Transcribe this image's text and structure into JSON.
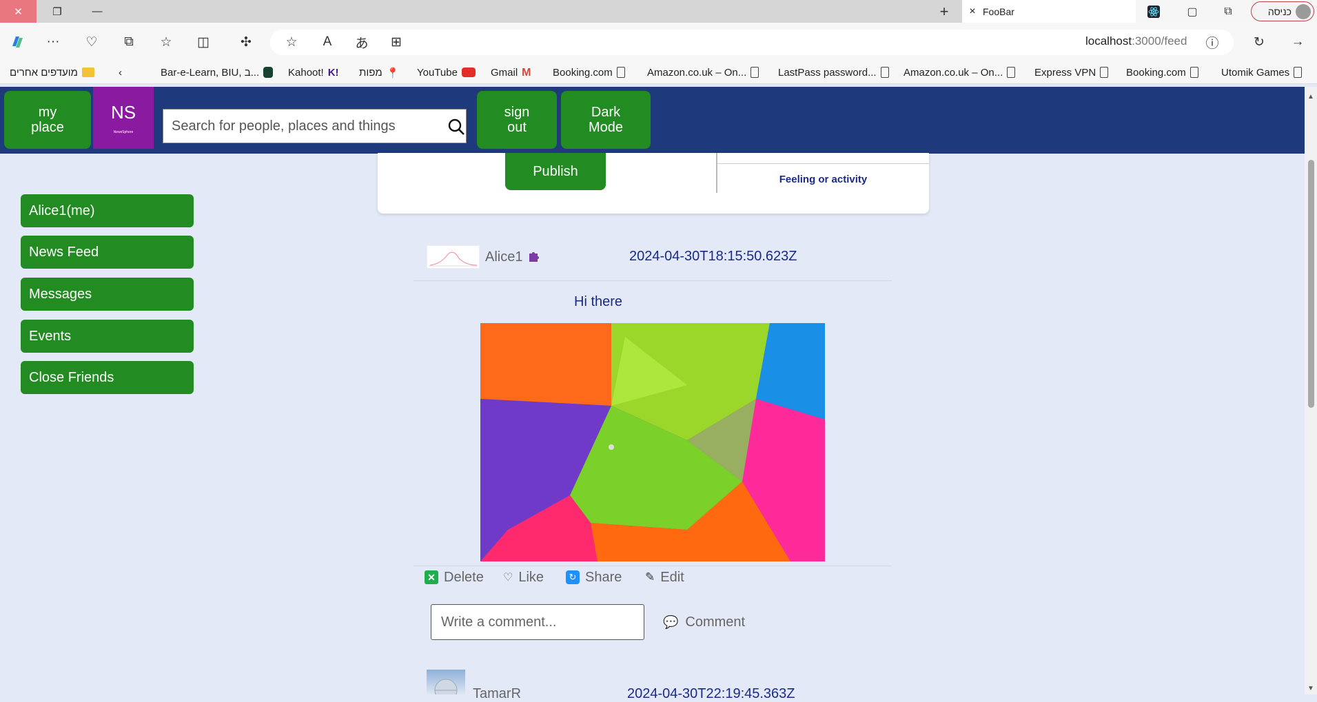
{
  "browser": {
    "tab_title": "FooBar",
    "profile_label": "כניסה",
    "address_host": "localhost",
    "address_path": ":3000/feed",
    "bookmarks": [
      {
        "label": "Bar-e-Learn, BIU, ב...",
        "icon": "biu-favicon"
      },
      {
        "label": "Kahoot!",
        "icon": "kahoot-favicon"
      },
      {
        "label": "מפות",
        "icon": "maps-pin-icon"
      },
      {
        "label": "YouTube",
        "icon": "youtube-favicon"
      },
      {
        "label": "Gmail",
        "icon": "gmail-favicon"
      },
      {
        "label": "Booking.com",
        "icon": "page-icon"
      },
      {
        "label": "Amazon.co.uk – On...",
        "icon": "page-icon"
      },
      {
        "label": "LastPass password...",
        "icon": "page-icon"
      },
      {
        "label": "Amazon.co.uk – On...",
        "icon": "page-icon"
      },
      {
        "label": "Express VPN",
        "icon": "page-icon"
      },
      {
        "label": "Booking.com",
        "icon": "page-icon"
      },
      {
        "label": "Utomik Games",
        "icon": "page-icon"
      }
    ],
    "other_favorites": "מועדפים אחרים"
  },
  "header": {
    "my_place": "my\nplace",
    "logo": "NS",
    "logo_tagline": "NewsSphere",
    "search_placeholder": "Search for people, places and things",
    "sign_out": "sign\nout",
    "dark_mode": "Dark\nMode"
  },
  "sidebar": {
    "items": [
      {
        "label": "Alice1(me)"
      },
      {
        "label": "News Feed"
      },
      {
        "label": "Messages"
      },
      {
        "label": "Events"
      },
      {
        "label": "Close Friends"
      }
    ]
  },
  "composer": {
    "publish": "Publish",
    "feeling": "Feeling or activity"
  },
  "post": {
    "author": "Alice1",
    "timestamp": "2024-04-30T18:15:50.623Z",
    "text": "Hi there",
    "actions": {
      "delete": "Delete",
      "like": "Like",
      "share": "Share",
      "edit": "Edit"
    },
    "comment_placeholder": "Write a comment...",
    "comment_button": "Comment"
  },
  "next_post": {
    "author": "TamarR",
    "timestamp": "2024-04-30T22:19:45.363Z"
  },
  "colors": {
    "header_bg": "#1e3a7c",
    "button_green": "#228b22",
    "logo_purple": "#8a1aa0",
    "page_bg": "#e3e9f7",
    "link_blue": "#1a2a8c"
  }
}
